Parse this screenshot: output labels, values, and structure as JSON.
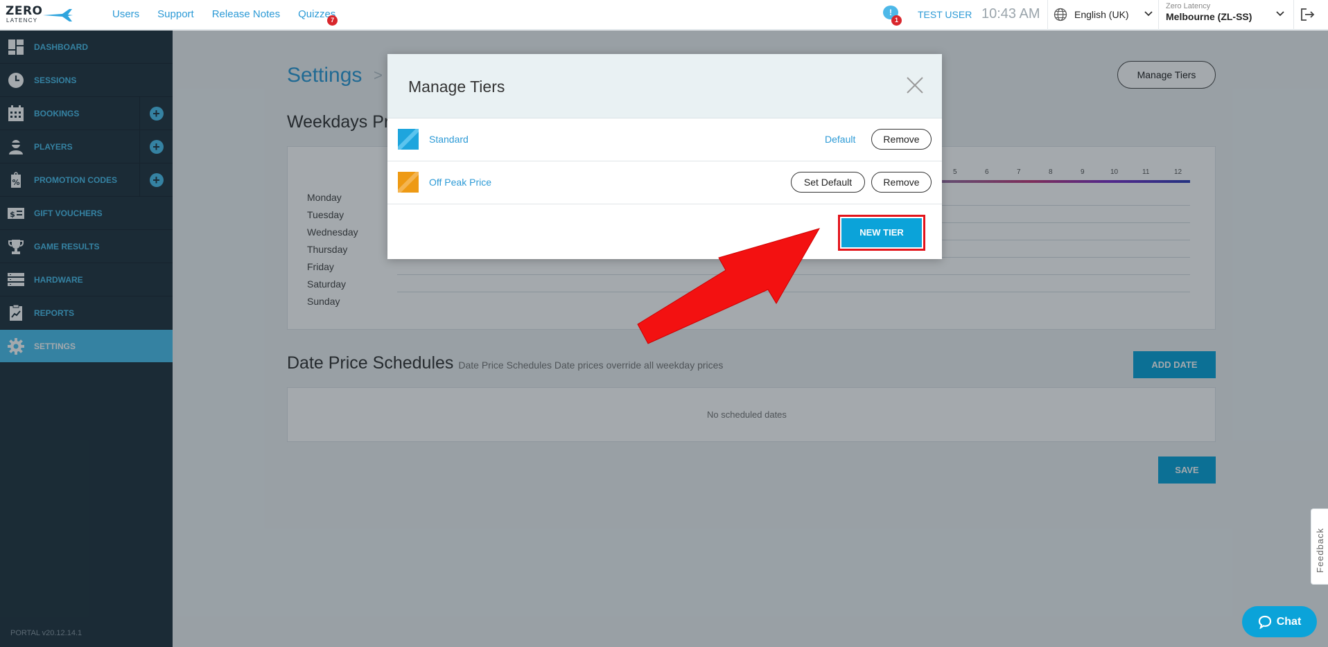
{
  "brand": {
    "line1": "ZERO",
    "line2": "LATENCY"
  },
  "topnav": {
    "items": [
      "Users",
      "Support",
      "Release Notes",
      "Quizzes"
    ],
    "quizzes_badge": "7"
  },
  "header": {
    "notif_badge": "1",
    "user": "TEST USER",
    "time": "10:43 AM",
    "language": "English (UK)",
    "site_org": "Zero Latency",
    "site_name": "Melbourne (ZL-SS)"
  },
  "sidebar": {
    "items": [
      {
        "label": "DASHBOARD",
        "icon": "dashboard-icon"
      },
      {
        "label": "SESSIONS",
        "icon": "clock-icon"
      },
      {
        "label": "BOOKINGS",
        "icon": "calendar-icon",
        "plus": true
      },
      {
        "label": "PLAYERS",
        "icon": "player-icon",
        "plus": true
      },
      {
        "label": "PROMOTION CODES",
        "icon": "promo-tag-icon",
        "plus": true
      },
      {
        "label": "GIFT VOUCHERS",
        "icon": "voucher-icon"
      },
      {
        "label": "GAME RESULTS",
        "icon": "trophy-icon"
      },
      {
        "label": "HARDWARE",
        "icon": "server-icon"
      },
      {
        "label": "REPORTS",
        "icon": "report-icon"
      },
      {
        "label": "SETTINGS",
        "icon": "gear-icon",
        "active": true
      }
    ],
    "version": "PORTAL v20.12.14.1",
    "collapse": "«"
  },
  "main": {
    "title": "Settings",
    "manage_tiers_button": "Manage Tiers",
    "weekdays_title": "Weekdays Pri",
    "days": [
      "Monday",
      "Tuesday",
      "Wednesday",
      "Thursday",
      "Friday",
      "Saturday",
      "Sunday"
    ],
    "hours": [
      "5",
      "6",
      "7",
      "8",
      "9",
      "10",
      "11",
      "12"
    ],
    "date_schedules_title": "Date Price Schedules",
    "date_schedules_subtitle": "Date Price Schedules Date prices override all weekday prices",
    "add_date_button": "ADD DATE",
    "no_dates": "No scheduled dates",
    "save_button": "SAVE"
  },
  "modal": {
    "title": "Manage Tiers",
    "tiers": [
      {
        "name": "Standard",
        "color": "#1ea5dd",
        "status": "Default",
        "remove": "Remove"
      },
      {
        "name": "Off Peak Price",
        "color": "#ee9a14",
        "set_default": "Set Default",
        "remove": "Remove"
      }
    ],
    "new_tier_button": "NEW TIER"
  },
  "feedback": "Feedback",
  "chat": "Chat",
  "colors": {
    "accent": "#0ba3d9",
    "sidebar": "#23343f",
    "highlight": "#e3141b"
  }
}
